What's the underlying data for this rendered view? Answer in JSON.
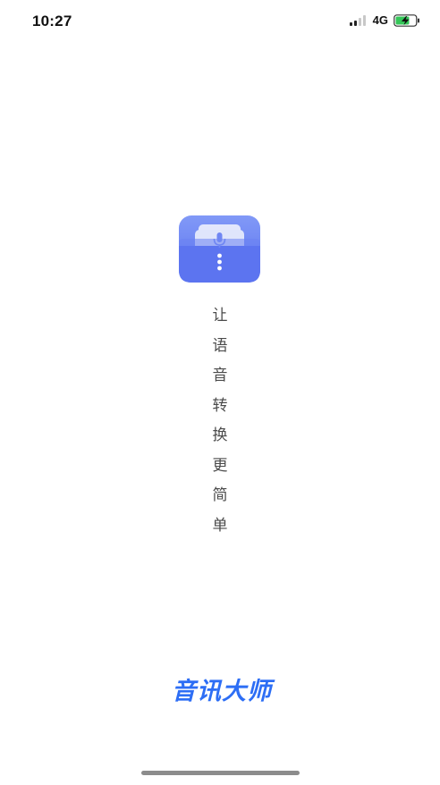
{
  "status_bar": {
    "time": "10:27",
    "network": "4G",
    "signal_icon": "signal-strength-icon",
    "battery_icon": "battery-charging-icon"
  },
  "app_icon": {
    "icon": "voice-folder-icon",
    "colors": {
      "gradient_top": "#7f97f7",
      "gradient_bottom": "#5c74f0",
      "card": "#dfe5fb",
      "mic": "#6f86f3"
    }
  },
  "slogan": {
    "chars": [
      "让",
      "语",
      "音",
      "转",
      "换",
      "更",
      "简",
      "单"
    ]
  },
  "brand": {
    "name": "音讯大师",
    "color": "#2d6ef5"
  }
}
